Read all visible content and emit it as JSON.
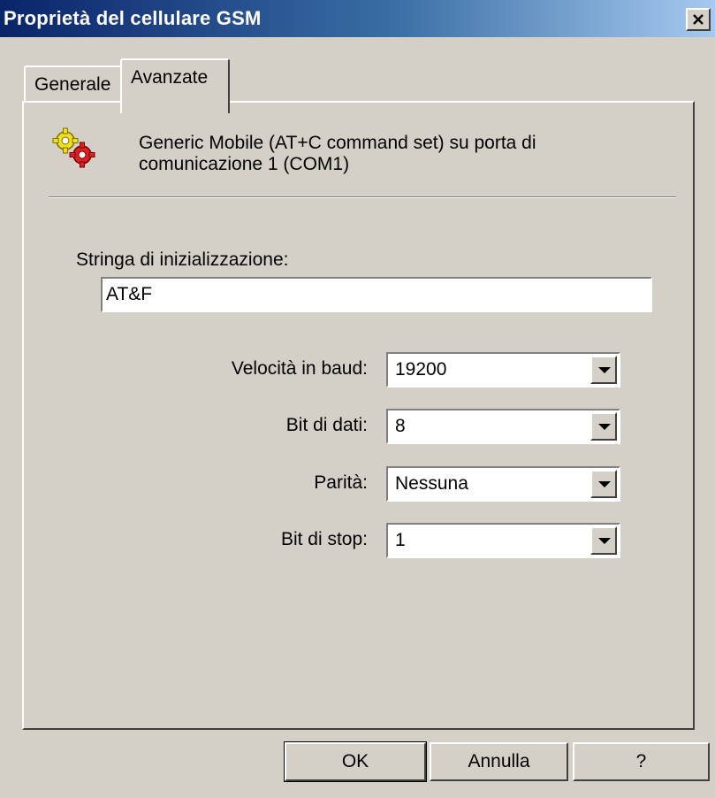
{
  "window": {
    "title": "Proprietà del cellulare GSM",
    "close_label": "✕"
  },
  "tabs": [
    {
      "label": "Generale",
      "selected": false
    },
    {
      "label": "Avanzate",
      "selected": true
    }
  ],
  "device": {
    "icon": "gears-icon",
    "description_line1": "Generic Mobile (AT+C command set) su porta di",
    "description_line2": "comunicazione 1 (COM1)"
  },
  "init": {
    "label": "Stringa di inizializzazione:",
    "value": "AT&F"
  },
  "settings": {
    "baud_label": "Velocità in baud:",
    "baud_value": "19200",
    "data_bits_label": "Bit di dati:",
    "data_bits_value": "8",
    "parity_label": "Parità:",
    "parity_value": "Nessuna",
    "stop_bits_label": "Bit di stop:",
    "stop_bits_value": "1"
  },
  "buttons": {
    "ok": "OK",
    "cancel": "Annulla",
    "help": "?"
  },
  "colors": {
    "title_start": "#0a246a",
    "title_end": "#a6caf0",
    "face": "#d4d0c8"
  }
}
